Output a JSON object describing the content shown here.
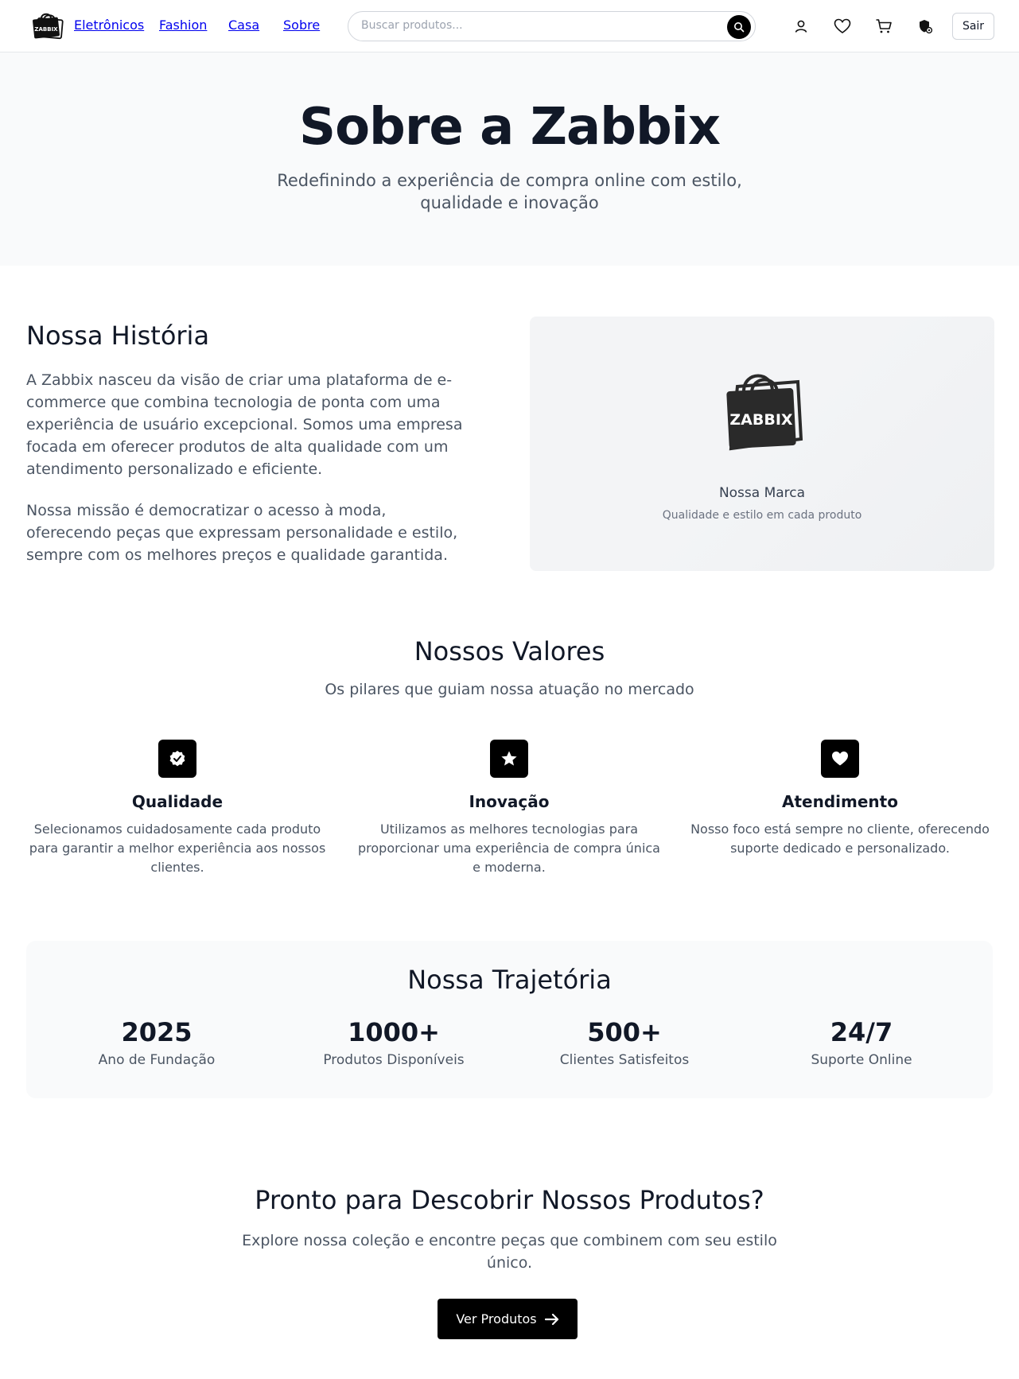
{
  "header": {
    "logo_text": "ZABBIX",
    "nav": [
      "Eletrônicos",
      "Fashion",
      "Casa",
      "Sobre"
    ],
    "search_placeholder": "Buscar produtos...",
    "logout_label": "Sair"
  },
  "hero": {
    "title": "Sobre a Zabbix",
    "subtitle": "Redefinindo a experiência de compra online com estilo, qualidade e inovação"
  },
  "history": {
    "title": "Nossa História",
    "paragraph1": "A Zabbix nasceu da visão de criar uma plataforma de e-commerce que combina tecnologia de ponta com uma experiência de usuário excepcional. Somos uma empresa focada em oferecer produtos de alta qualidade com um atendimento personalizado e eficiente.",
    "paragraph2": "Nossa missão é democratizar o acesso à moda, oferecendo peças que expressam personalidade e estilo, sempre com os melhores preços e qualidade garantida.",
    "brand_card": {
      "logo_text": "ZABBIX",
      "title": "Nossa Marca",
      "subtitle": "Qualidade e estilo em cada produto"
    }
  },
  "values": {
    "title": "Nossos Valores",
    "subtitle": "Os pilares que guiam nossa atuação no mercado",
    "items": [
      {
        "icon": "badge-check-icon",
        "title": "Qualidade",
        "text": "Selecionamos cuidadosamente cada produto para garantir a melhor experiência aos nossos clientes."
      },
      {
        "icon": "star-icon",
        "title": "Inovação",
        "text": "Utilizamos as melhores tecnologias para proporcionar uma experiência de compra única e moderna."
      },
      {
        "icon": "heart-icon",
        "title": "Atendimento",
        "text": "Nosso foco está sempre no cliente, oferecendo suporte dedicado e personalizado."
      }
    ]
  },
  "trajectory": {
    "title": "Nossa Trajetória",
    "stats": [
      {
        "value": "2025",
        "label": "Ano de Fundação"
      },
      {
        "value": "1000+",
        "label": "Produtos Disponíveis"
      },
      {
        "value": "500+",
        "label": "Clientes Satisfeitos"
      },
      {
        "value": "24/7",
        "label": "Suporte Online"
      }
    ]
  },
  "cta": {
    "title": "Pronto para Descobrir Nossos Produtos?",
    "text": "Explore nossa coleção e encontre peças que combinem com seu estilo único.",
    "button_label": "Ver Produtos"
  },
  "colors": {
    "accent": "#000000",
    "text": "#111827",
    "muted": "#4b5563",
    "section_bg": "#f9fafb"
  }
}
